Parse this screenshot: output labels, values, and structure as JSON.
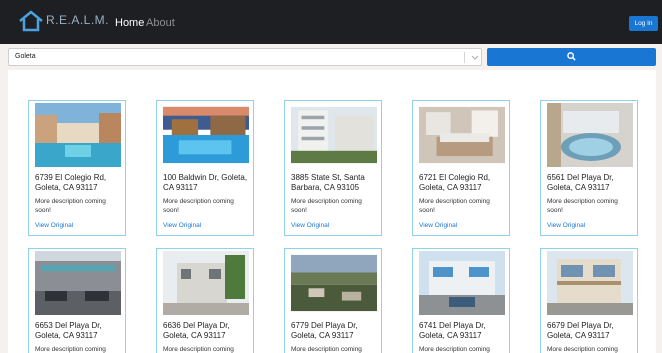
{
  "navbar": {
    "brand": "R.E.A.L.M.",
    "home": "Home",
    "about": "About",
    "login": "Log In"
  },
  "search": {
    "value": "Goleta"
  },
  "listings": [
    {
      "address": "6739 El Colegio Rd, Goleta, CA 93117",
      "description": "More description coming soon!",
      "link": "View Original"
    },
    {
      "address": "100 Baldwin Dr, Goleta, CA 93117",
      "description": "More description coming soon!",
      "link": "View Original"
    },
    {
      "address": "3885 State St, Santa Barbara, CA 93105",
      "description": "More description coming soon!",
      "link": "View Original"
    },
    {
      "address": "6721 El Colegio Rd, Goleta, CA 93117",
      "description": "More description coming soon!",
      "link": "View Original"
    },
    {
      "address": "6561 Del Playa Dr, Goleta, CA 93117",
      "description": "More description coming soon!",
      "link": "View Original"
    },
    {
      "address": "6653 Del Playa Dr, Goleta, CA 93117",
      "description": "More description coming",
      "link": ""
    },
    {
      "address": "6636 Del Playa Dr, Goleta, CA 93117",
      "description": "More description coming",
      "link": ""
    },
    {
      "address": "6779 Del Playa Dr, Goleta, CA 93117",
      "description": "More description coming",
      "link": ""
    },
    {
      "address": "6741 Del Playa Dr, Goleta, CA 93117",
      "description": "More description coming",
      "link": ""
    },
    {
      "address": "6679 Del Playa Dr, Goleta, CA 93117",
      "description": "More description coming",
      "link": ""
    }
  ]
}
